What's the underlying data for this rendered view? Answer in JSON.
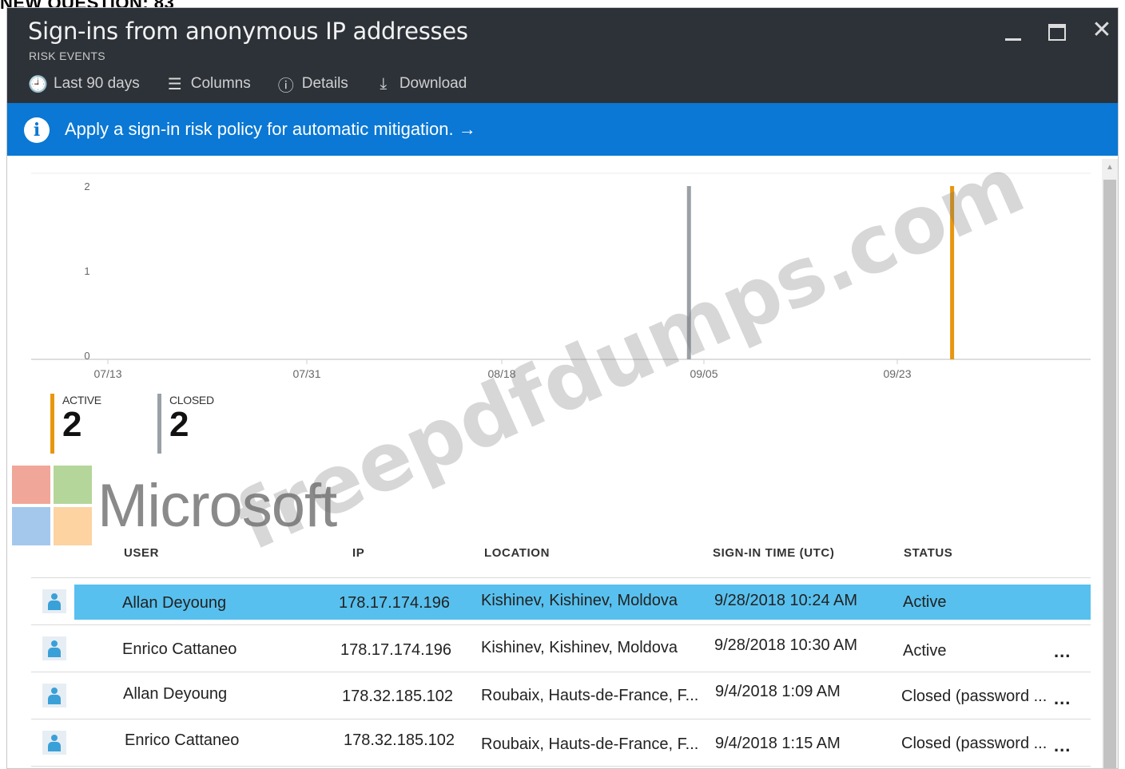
{
  "banner": "NEW QUESTION: 83",
  "window": {
    "title": "Sign-ins from anonymous IP addresses",
    "subtitle": "RISK EVENTS",
    "controls": {
      "minimize": "minimize",
      "maximize": "maximize",
      "close": "✕"
    }
  },
  "toolbar": {
    "items": [
      {
        "label": "Last 90 days",
        "icon": "clock-icon",
        "glyph": "🕘"
      },
      {
        "label": "Columns",
        "icon": "columns-icon",
        "glyph": "☰"
      },
      {
        "label": "Details",
        "icon": "info-icon",
        "glyph": "ⓘ"
      },
      {
        "label": "Download",
        "icon": "download-icon",
        "glyph": "⤓"
      }
    ]
  },
  "info_bar": {
    "text": "Apply a sign-in risk policy for automatic mitigation. →",
    "icon": "info-icon",
    "glyph": "i",
    "color": "#0a78d4"
  },
  "chart_data": {
    "type": "bar",
    "x_ticks": [
      "07/13",
      "07/31",
      "08/18",
      "09/05",
      "09/23"
    ],
    "y_ticks": [
      "0",
      "1",
      "2"
    ],
    "ylim": [
      0,
      2
    ],
    "series": [
      {
        "name": "CLOSED",
        "color": "#9aa0a6",
        "points": [
          {
            "x": "09/04",
            "y": 2
          }
        ]
      },
      {
        "name": "ACTIVE",
        "color": "#e8960f",
        "points": [
          {
            "x": "09/28",
            "y": 2
          }
        ]
      }
    ]
  },
  "summary": {
    "active": {
      "label": "ACTIVE",
      "value": "2",
      "color": "#e8960f"
    },
    "closed": {
      "label": "CLOSED",
      "value": "2",
      "color": "#9aa0a6"
    }
  },
  "overlay": {
    "logo_text": "Microsoft",
    "watermark": "freepdfdumps.com"
  },
  "table": {
    "columns": [
      "USER",
      "IP",
      "LOCATION",
      "SIGN-IN TIME (UTC)",
      "STATUS"
    ],
    "rows": [
      {
        "user": "Allan Deyoung",
        "ip": "178.17.174.196",
        "location": "Kishinev, Kishinev, Moldova",
        "time": "9/28/2018 10:24 AM",
        "status": "Active",
        "more": ""
      },
      {
        "user": "Enrico Cattaneo",
        "ip": "178.17.174.196",
        "location": "Kishinev, Kishinev, Moldova",
        "time": "9/28/2018 10:30 AM",
        "status": "Active",
        "more": "..."
      },
      {
        "user": "Allan Deyoung",
        "ip": "178.32.185.102",
        "location": "Roubaix, Hauts-de-France, F...",
        "time": "9/4/2018 1:09 AM",
        "status": "Closed (password ...",
        "more": "..."
      },
      {
        "user": "Enrico Cattaneo",
        "ip": "178.32.185.102",
        "location": "Roubaix, Hauts-de-France, F...",
        "time": "9/4/2018 1:15 AM",
        "status": "Closed (password ...",
        "more": "..."
      }
    ]
  }
}
